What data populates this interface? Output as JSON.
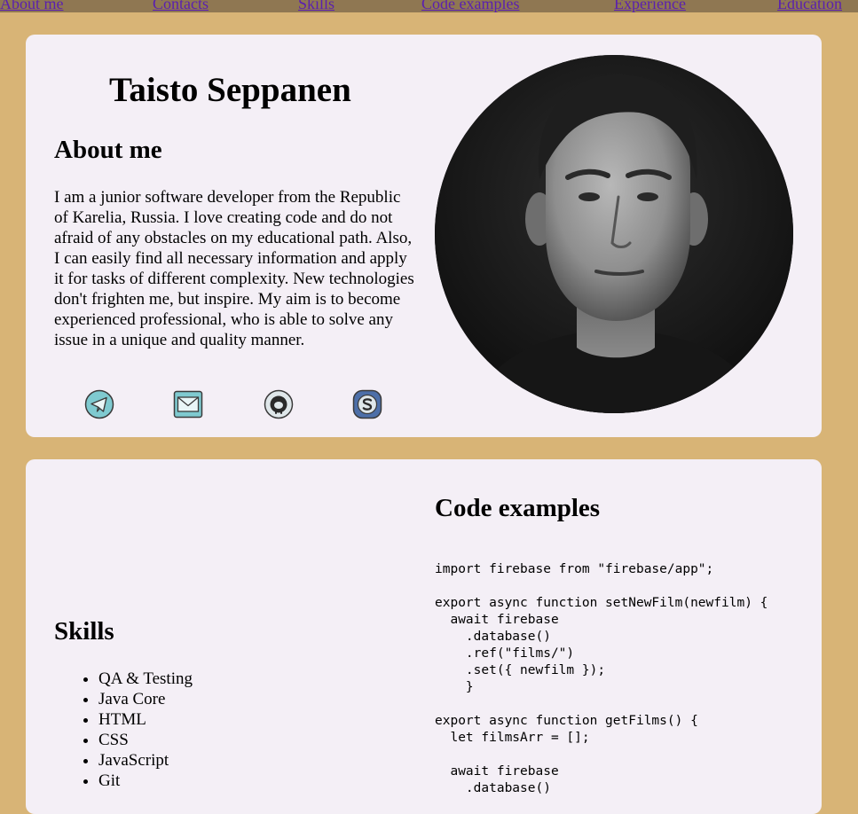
{
  "nav": {
    "items": [
      {
        "label": "About me"
      },
      {
        "label": "Contacts"
      },
      {
        "label": "Skills"
      },
      {
        "label": "Code examples"
      },
      {
        "label": "Experience"
      },
      {
        "label": "Education"
      }
    ]
  },
  "profile": {
    "name": "Taisto Seppanen",
    "about_heading": "About me",
    "about_text": "I am a junior software developer from the Republic of Karelia, Russia. I love creating code and do not afraid of any obstacles on my educational path. Also, I can easily find all necessary information and apply it for tasks of different complexity. New technologies don't frighten me, but inspire. My aim is to become experienced professional, who is able to solve any issue in a unique and quality manner.",
    "contacts": [
      "telegram-icon",
      "email-icon",
      "github-icon",
      "skype-icon"
    ]
  },
  "skills": {
    "heading": "Skills",
    "items": [
      "QA & Testing",
      "Java Core",
      "HTML",
      "CSS",
      "JavaScript",
      "Git"
    ]
  },
  "code_examples": {
    "heading": "Code examples",
    "code": "import firebase from \"firebase/app\";\n\nexport async function setNewFilm(newfilm) {\n  await firebase\n    .database()\n    .ref(\"films/\")\n    .set({ newfilm });\n    }\n\nexport async function getFilms() {\n  let filmsArr = [];\n\n  await firebase\n    .database()"
  },
  "colors": {
    "page_bg": "#d8b476",
    "nav_bg": "#8f7752",
    "card_bg": "#f4eff6",
    "link": "#5a1fb0",
    "icon_teal": "#7fcad0",
    "icon_skype": "#4d6fa8"
  }
}
